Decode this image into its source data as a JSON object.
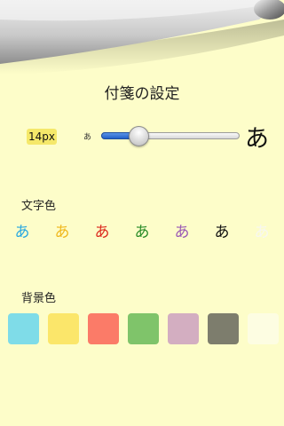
{
  "header": {
    "title": "付箋の設定"
  },
  "font_size": {
    "value_label": "14px",
    "small_sample": "あ",
    "large_sample": "あ",
    "slider_fraction": 0.23
  },
  "text_color": {
    "label": "文字色",
    "options": [
      {
        "glyph": "あ",
        "color": "#2aa8e0"
      },
      {
        "glyph": "あ",
        "color": "#f0b81e"
      },
      {
        "glyph": "あ",
        "color": "#dc2a1e"
      },
      {
        "glyph": "あ",
        "color": "#2a8c28"
      },
      {
        "glyph": "あ",
        "color": "#9b5ab4"
      },
      {
        "glyph": "あ",
        "color": "#111111"
      },
      {
        "glyph": "あ",
        "color": "#f7f7f1"
      }
    ]
  },
  "background_color": {
    "label": "背景色",
    "options": [
      "#7fdce8",
      "#fbe66a",
      "#fb7b68",
      "#7fc46a",
      "#d3aec1",
      "#7d7d6d",
      "#fdfde2"
    ]
  }
}
